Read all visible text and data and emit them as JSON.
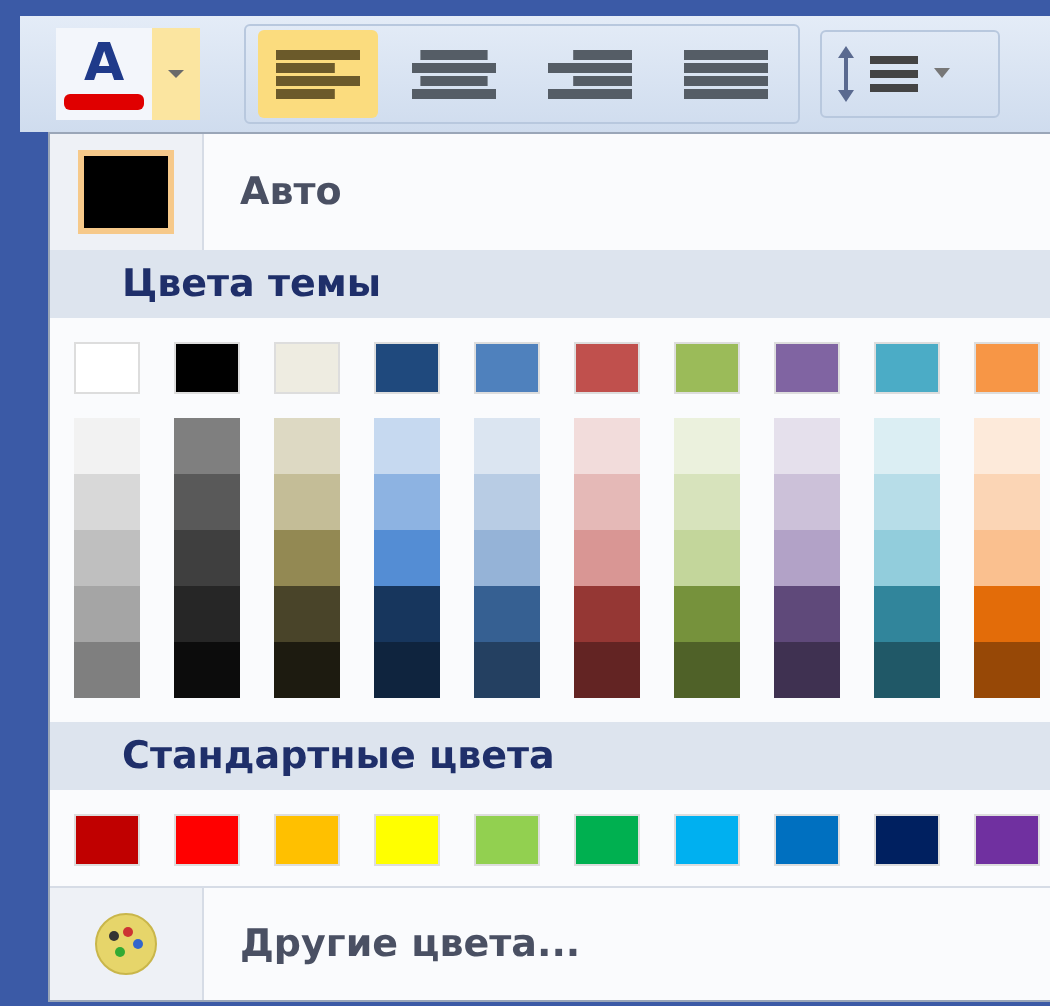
{
  "toolbar": {
    "font_color_button": {
      "glyph": "A",
      "color": "#e00000",
      "expanded": true
    },
    "align_buttons": [
      {
        "selected": true
      },
      {
        "selected": false
      },
      {
        "selected": false
      },
      {
        "selected": false
      }
    ],
    "line_spacing_button": {
      "expanded": false
    }
  },
  "menu": {
    "auto": {
      "label": "Авто",
      "color": "#000000"
    },
    "theme_header": "Цвета темы",
    "theme_colors": [
      {
        "color": "#ffffff",
        "shades": [
          {
            "color": "#f2f2f2"
          },
          {
            "color": "#d8d8d8"
          },
          {
            "color": "#bfbfbf"
          },
          {
            "color": "#a5a5a5"
          },
          {
            "color": "#7f7f7f"
          }
        ]
      },
      {
        "color": "#000000",
        "shades": [
          {
            "color": "#7f7f7f"
          },
          {
            "color": "#595959"
          },
          {
            "color": "#3f3f3f"
          },
          {
            "color": "#262626"
          },
          {
            "color": "#0c0c0c"
          }
        ]
      },
      {
        "color": "#eeece1",
        "shades": [
          {
            "color": "#ddd9c3"
          },
          {
            "color": "#c4bd97"
          },
          {
            "color": "#938953"
          },
          {
            "color": "#494429"
          },
          {
            "color": "#1d1b10"
          }
        ]
      },
      {
        "color": "#1f497d",
        "shades": [
          {
            "color": "#c6d9f0"
          },
          {
            "color": "#8db3e2"
          },
          {
            "color": "#548dd4"
          },
          {
            "color": "#17365d"
          },
          {
            "color": "#0f243e"
          }
        ]
      },
      {
        "color": "#4f81bd",
        "shades": [
          {
            "color": "#dbe5f1"
          },
          {
            "color": "#b8cce4"
          },
          {
            "color": "#95b3d7"
          },
          {
            "color": "#366092"
          },
          {
            "color": "#244061"
          }
        ]
      },
      {
        "color": "#c0504d",
        "shades": [
          {
            "color": "#f2dcdb"
          },
          {
            "color": "#e5b9b7"
          },
          {
            "color": "#d99694"
          },
          {
            "color": "#953734"
          },
          {
            "color": "#632423"
          }
        ]
      },
      {
        "color": "#9bbb59",
        "shades": [
          {
            "color": "#ebf1dd"
          },
          {
            "color": "#d7e3bc"
          },
          {
            "color": "#c3d69b"
          },
          {
            "color": "#76923c"
          },
          {
            "color": "#4f6128"
          }
        ]
      },
      {
        "color": "#8064a2",
        "shades": [
          {
            "color": "#e5e0ec"
          },
          {
            "color": "#ccc1d9"
          },
          {
            "color": "#b2a2c7"
          },
          {
            "color": "#5f497a"
          },
          {
            "color": "#3f3151"
          }
        ]
      },
      {
        "color": "#4bacc6",
        "shades": [
          {
            "color": "#dbeef3"
          },
          {
            "color": "#b7dde8"
          },
          {
            "color": "#92cddc"
          },
          {
            "color": "#31859b"
          },
          {
            "color": "#205867"
          }
        ]
      },
      {
        "color": "#f79646",
        "shades": [
          {
            "color": "#fdeada"
          },
          {
            "color": "#fbd5b5"
          },
          {
            "color": "#fac08f"
          },
          {
            "color": "#e36c09"
          },
          {
            "color": "#974806"
          }
        ]
      }
    ],
    "standard_header": "Стандартные цвета",
    "standard_colors": [
      {
        "color": "#c00000"
      },
      {
        "color": "#ff0000"
      },
      {
        "color": "#ffc000"
      },
      {
        "color": "#ffff00"
      },
      {
        "color": "#92d050"
      },
      {
        "color": "#00b050"
      },
      {
        "color": "#00b0f0"
      },
      {
        "color": "#0070c0"
      },
      {
        "color": "#002060"
      },
      {
        "color": "#7030a0"
      }
    ],
    "more_colors": "Другие цвета..."
  }
}
